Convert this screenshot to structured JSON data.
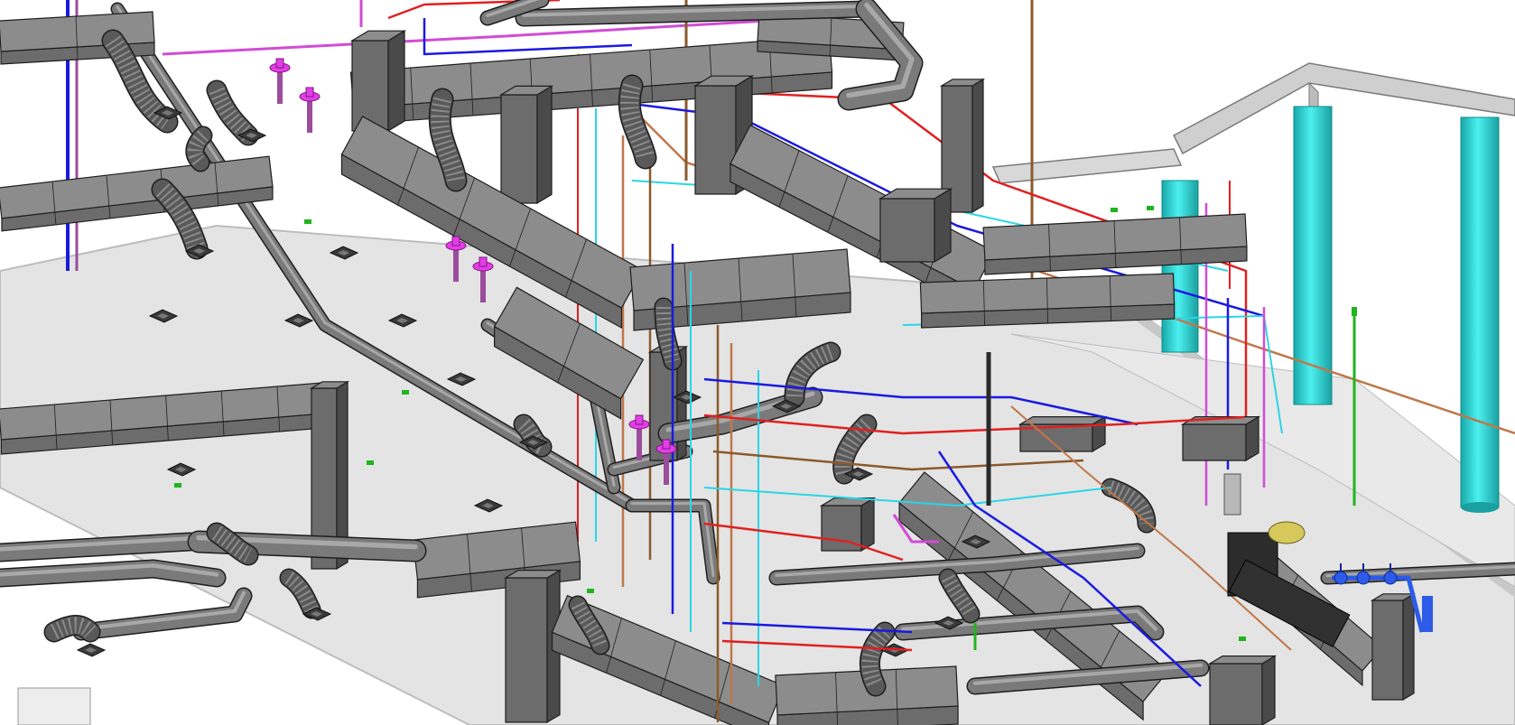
{
  "view": {
    "kind": "3D isometric MEP coordination model",
    "background": "#ffffff"
  },
  "colors": {
    "slab_top": "#e4e4e4",
    "slab_edge": "#bdbdbd",
    "duct_top": "#8c8c8c",
    "duct_side": "#6c6c6c",
    "duct_dark": "#4a4a4a",
    "duct_outline": "#1e1e1e",
    "flex_duct": "#595959",
    "diffuser": "#3a3a3a",
    "column": "#33e0e0",
    "column_shade": "#1fb0b0",
    "beam": "#cfcfcf",
    "pipe_magenta": "#d24bd6",
    "pipe_purple": "#9b4d9b",
    "pipe_red": "#e02020",
    "pipe_blue": "#1a1ae0",
    "pipe_cyan": "#29d6e6",
    "pipe_orange": "#c0774a",
    "pipe_brown": "#8b5a2b",
    "pipe_green": "#1fb51f",
    "sprinkler": "#e43de8",
    "valve_blue": "#2d5be8",
    "equipment_yellow": "#d6c85a"
  },
  "legend_systems": [
    {
      "name": "supply-air-duct",
      "color_key": "duct_side"
    },
    {
      "name": "flexible-duct",
      "color_key": "flex_duct"
    },
    {
      "name": "fire-sprinkler-pipe",
      "color_key": "pipe_magenta"
    },
    {
      "name": "hot-water-pipe",
      "color_key": "pipe_red"
    },
    {
      "name": "cold-water-pipe",
      "color_key": "pipe_blue"
    },
    {
      "name": "chilled-water-pipe",
      "color_key": "pipe_cyan"
    },
    {
      "name": "drain-pipe",
      "color_key": "pipe_orange"
    },
    {
      "name": "gas-pipe",
      "color_key": "pipe_green"
    },
    {
      "name": "structural-column",
      "color_key": "column"
    }
  ]
}
